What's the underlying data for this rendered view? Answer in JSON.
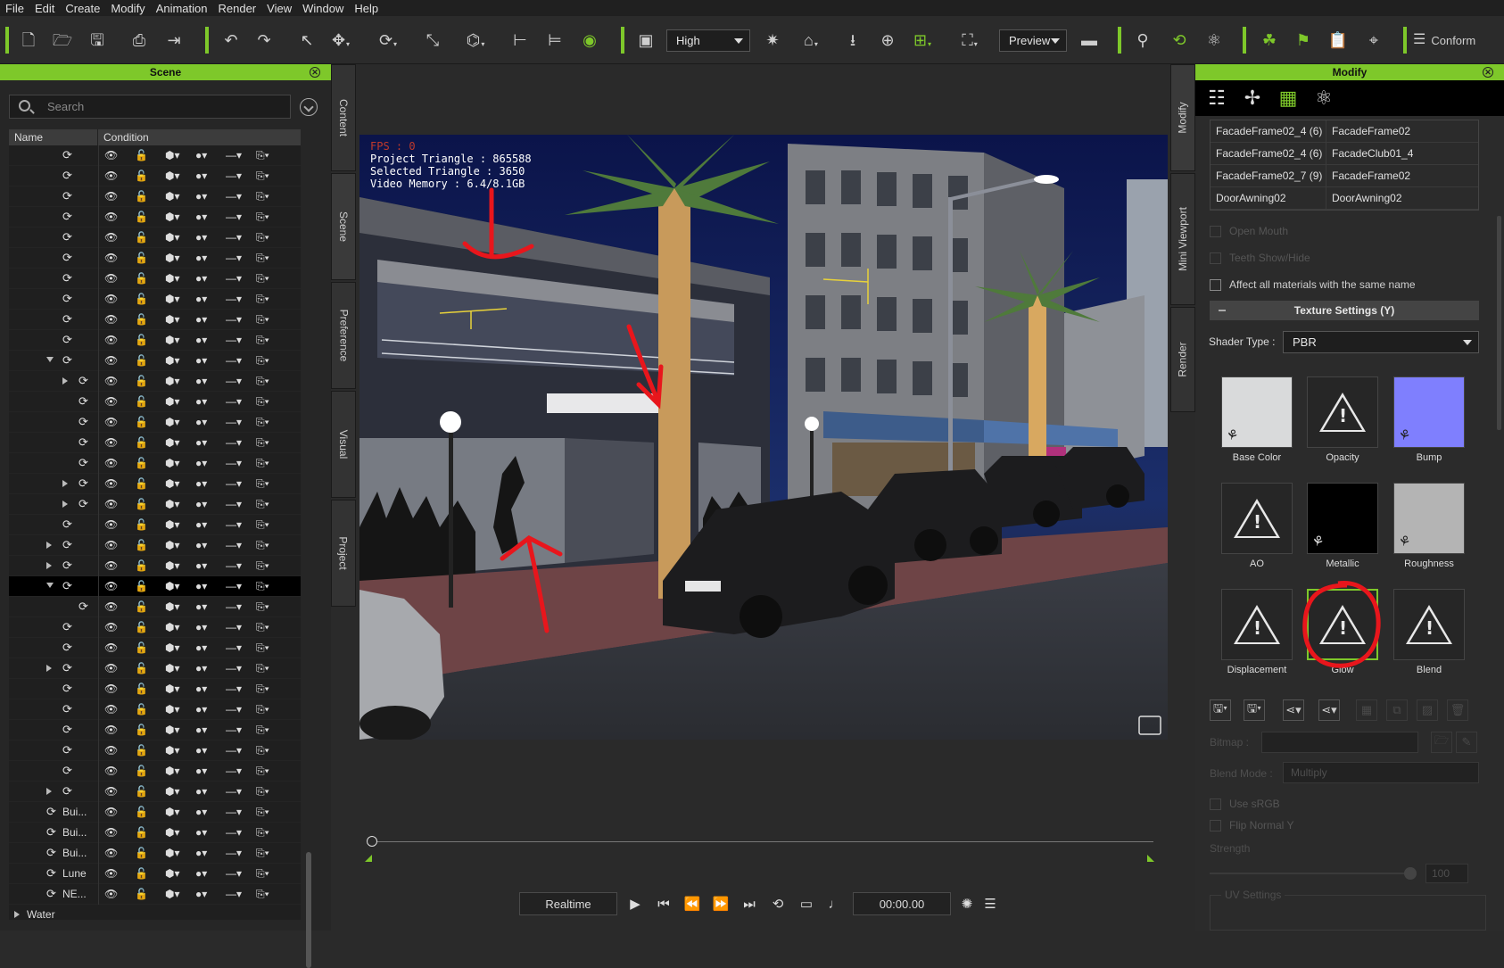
{
  "menu": [
    "File",
    "Edit",
    "Create",
    "Modify",
    "Animation",
    "Render",
    "View",
    "Window",
    "Help"
  ],
  "toolbar": {
    "quality": "High",
    "preview": "Preview",
    "conform": "Conform",
    "accent_color": "#7ec82a"
  },
  "scene_panel": {
    "title": "Scene",
    "search_placeholder": "Search",
    "columns": {
      "name": "Name",
      "condition": "Condition"
    },
    "rows": [
      {
        "name": "",
        "tri": "",
        "indent": 0
      },
      {
        "name": "",
        "tri": "",
        "indent": 0
      },
      {
        "name": "",
        "tri": "",
        "indent": 0
      },
      {
        "name": "",
        "tri": "",
        "indent": 0
      },
      {
        "name": "",
        "tri": "",
        "indent": 0
      },
      {
        "name": "",
        "tri": "",
        "indent": 0
      },
      {
        "name": "",
        "tri": "",
        "indent": 0
      },
      {
        "name": "",
        "tri": "",
        "indent": 0
      },
      {
        "name": "",
        "tri": "",
        "indent": 0
      },
      {
        "name": "",
        "tri": "",
        "indent": 0
      },
      {
        "name": "",
        "tri": "exp",
        "indent": 0
      },
      {
        "name": "",
        "tri": "col",
        "indent": 1
      },
      {
        "name": "",
        "tri": "",
        "indent": 1
      },
      {
        "name": "",
        "tri": "",
        "indent": 1
      },
      {
        "name": "",
        "tri": "",
        "indent": 1
      },
      {
        "name": "",
        "tri": "",
        "indent": 1
      },
      {
        "name": "",
        "tri": "col",
        "indent": 1
      },
      {
        "name": "",
        "tri": "col",
        "indent": 1
      },
      {
        "name": "",
        "tri": "",
        "indent": 0
      },
      {
        "name": "",
        "tri": "col",
        "indent": 0
      },
      {
        "name": "",
        "tri": "col",
        "indent": 0
      },
      {
        "name": "",
        "tri": "exp",
        "indent": 0,
        "selected": true
      },
      {
        "name": "",
        "tri": "",
        "indent": 1
      },
      {
        "name": "",
        "tri": "",
        "indent": 0
      },
      {
        "name": "",
        "tri": "",
        "indent": 0
      },
      {
        "name": "",
        "tri": "col",
        "indent": 0
      },
      {
        "name": "",
        "tri": "",
        "indent": 0
      },
      {
        "name": "",
        "tri": "",
        "indent": 0
      },
      {
        "name": "",
        "tri": "",
        "indent": 0
      },
      {
        "name": "",
        "tri": "",
        "indent": 0
      },
      {
        "name": "",
        "tri": "",
        "indent": 0
      },
      {
        "name": "",
        "tri": "col",
        "indent": 0
      },
      {
        "name": "Bui...",
        "tri": "",
        "indent": -1
      },
      {
        "name": "Bui...",
        "tri": "",
        "indent": -1
      },
      {
        "name": "Bui...",
        "tri": "",
        "indent": -1
      },
      {
        "name": "Lune",
        "tri": "",
        "indent": -1
      },
      {
        "name": "NE...",
        "tri": "",
        "indent": -1
      },
      {
        "name": "Water",
        "tri": "col",
        "indent": -3
      }
    ]
  },
  "left_tabs": [
    "Content",
    "Scene",
    "Preference",
    "Visual",
    "Project"
  ],
  "right_tabs": [
    "Modify",
    "Mini Viewport",
    "Render"
  ],
  "viewport": {
    "fps": "FPS : 0",
    "project_triangle": "Project Triangle : 865588",
    "selected_triangle": "Selected Triangle : 3650",
    "video_memory": "Video Memory : 6.4/8.1GB"
  },
  "playback": {
    "mode": "Realtime",
    "time": "00:00.00"
  },
  "modify_panel": {
    "title": "Modify",
    "materials": [
      [
        "FacadeFrame02_4 (6)",
        "FacadeFrame02"
      ],
      [
        "FacadeFrame02_4 (6)",
        "FacadeClub01_4"
      ],
      [
        "FacadeFrame02_7 (9)",
        "FacadeFrame02"
      ],
      [
        "DoorAwning02",
        "DoorAwning02"
      ]
    ],
    "open_mouth": "Open Mouth",
    "teeth_show_hide": "Teeth Show/Hide",
    "affect_all": "Affect all materials with the same name",
    "texture_settings": "Texture Settings  (Y)",
    "shader_type_label": "Shader Type :",
    "shader_type": "PBR",
    "slots": [
      "Base Color",
      "Opacity",
      "Bump",
      "AO",
      "Metallic",
      "Roughness",
      "Displacement",
      "Glow",
      "Blend"
    ],
    "bitmap_label": "Bitmap :",
    "blend_mode_label": "Blend Mode :",
    "blend_mode": "Multiply",
    "use_srgb": "Use sRGB",
    "flip_normal_y": "Flip Normal Y",
    "strength_label": "Strength",
    "strength_value": "100",
    "uv_settings": "UV Settings"
  }
}
